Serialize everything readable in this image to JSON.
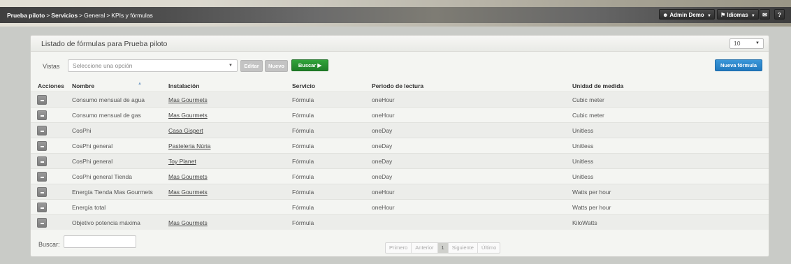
{
  "breadcrumb": {
    "items": [
      "Prueba piloto",
      "Servicios",
      "General",
      "KPIs y fórmulas"
    ],
    "separator": ">"
  },
  "topbar": {
    "user_label": "Admin Demo",
    "languages_label": "Idiomas",
    "user_icon": "user-icon",
    "flag_icon": "flag-icon",
    "message_icon": "message-icon",
    "help_label": "?"
  },
  "panel": {
    "title": "Listado de fórmulas para Prueba piloto",
    "page_size": "10"
  },
  "toolbar": {
    "vistas_label": "Vistas",
    "vistas_placeholder": "Seleccione una opción",
    "edit_label": "Editar",
    "new_label": "Nuevo",
    "search_label": "Buscar",
    "new_formula_label": "Nueva fórmula"
  },
  "table": {
    "columns": [
      "Acciones",
      "Nombre",
      "Instalación",
      "Servicio",
      "Periodo de lectura",
      "Unidad de medida"
    ],
    "rows": [
      {
        "nombre": "Consumo mensual de agua",
        "instalacion": "Mas Gourmets",
        "servicio": "Fórmula",
        "periodo": "oneHour",
        "unidad": "Cubic meter"
      },
      {
        "nombre": "Consumo mensual de gas",
        "instalacion": "Mas Gourmets",
        "servicio": "Fórmula",
        "periodo": "oneHour",
        "unidad": "Cubic meter"
      },
      {
        "nombre": "CosPhi",
        "instalacion": "Casa Gispert",
        "servicio": "Fórmula",
        "periodo": "oneDay",
        "unidad": "Unitless"
      },
      {
        "nombre": "CosPhi general",
        "instalacion": "Pasteleria Núria",
        "servicio": "Fórmula",
        "periodo": "oneDay",
        "unidad": "Unitless"
      },
      {
        "nombre": "CosPhi general",
        "instalacion": "Toy Planet",
        "servicio": "Fórmula",
        "periodo": "oneDay",
        "unidad": "Unitless"
      },
      {
        "nombre": "CosPhi general Tienda",
        "instalacion": "Mas Gourmets",
        "servicio": "Fórmula",
        "periodo": "oneDay",
        "unidad": "Unitless"
      },
      {
        "nombre": "Energía Tienda Mas Gourmets",
        "instalacion": "Mas Gourmets",
        "servicio": "Fórmula",
        "periodo": "oneHour",
        "unidad": "Watts per hour"
      },
      {
        "nombre": "Energía total",
        "instalacion": "",
        "servicio": "Fórmula",
        "periodo": "oneHour",
        "unidad": "Watts per hour"
      },
      {
        "nombre": "Objetivo potencia máxima",
        "instalacion": "Mas Gourmets",
        "servicio": "Fórmula",
        "periodo": "",
        "unidad": "KiloWatts"
      }
    ]
  },
  "footer": {
    "search_label": "Buscar:",
    "pager": {
      "first": "Primero",
      "prev": "Anterior",
      "current": "1",
      "next": "Siguiente",
      "last": "Último"
    }
  }
}
